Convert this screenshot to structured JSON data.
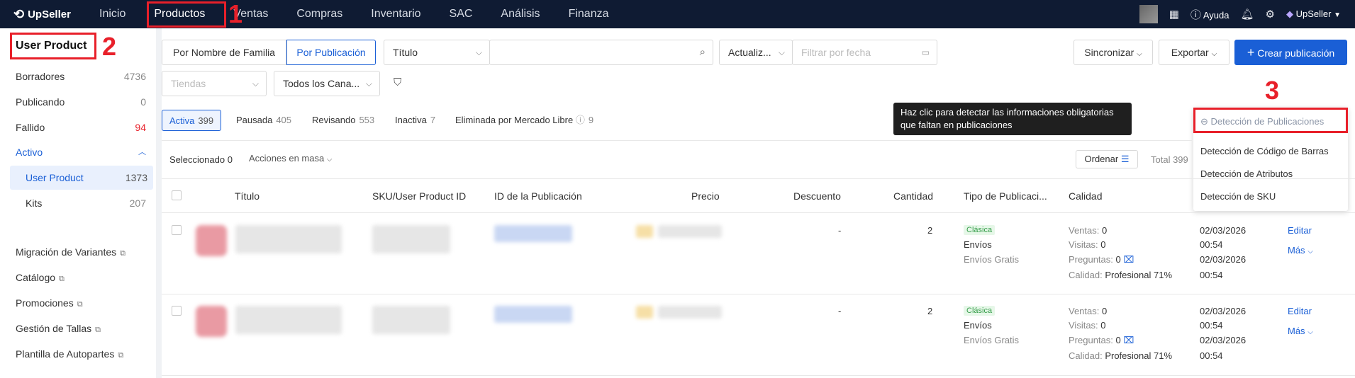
{
  "topbar": {
    "logo": "UpSeller",
    "nav": [
      "Inicio",
      "Productos",
      "Ventas",
      "Compras",
      "Inventario",
      "SAC",
      "Análisis",
      "Finanza"
    ],
    "help": "Ayuda",
    "account": "UpSeller"
  },
  "annotations": [
    "1",
    "2",
    "3"
  ],
  "sidebar": {
    "title": "User Product",
    "items": [
      {
        "label": "Borradores",
        "count": "4736"
      },
      {
        "label": "Publicando",
        "count": "0"
      },
      {
        "label": "Fallido",
        "count": "94"
      },
      {
        "label": "Activo",
        "count": ""
      },
      {
        "label": "User Product",
        "count": "1373"
      },
      {
        "label": "Kits",
        "count": "207"
      },
      {
        "label": "Migración de Variantes",
        "count": ""
      },
      {
        "label": "Catálogo",
        "count": ""
      },
      {
        "label": "Promociones",
        "count": ""
      },
      {
        "label": "Gestión de Tallas",
        "count": ""
      },
      {
        "label": "Plantilla de Autopartes",
        "count": ""
      }
    ],
    "colors": {
      "accent": "#1a5fd6",
      "fail_count": "#e8202a"
    }
  },
  "filters": {
    "mode_family": "Por Nombre de Familia",
    "mode_publication": "Por Publicación",
    "title_select": "Título",
    "search_value": "",
    "updated_select": "Actualiz...",
    "date_placeholder": "Filtrar por fecha",
    "sync": "Sincronizar",
    "export": "Exportar",
    "create": "Crear publicación",
    "stores_placeholder": "Tiendas",
    "channels": "Todos los Cana..."
  },
  "status_tabs": [
    {
      "label": "Activa",
      "count": "399"
    },
    {
      "label": "Pausada",
      "count": "405"
    },
    {
      "label": "Revisando",
      "count": "553"
    },
    {
      "label": "Inactiva",
      "count": "7"
    },
    {
      "label": "Eliminada por Mercado Libre",
      "count": "9"
    }
  ],
  "tooltip": "Haz clic para detectar las informaciones obligatorias que faltan en publicaciones",
  "detection": {
    "header": "Detección de Publicaciones",
    "items": [
      "Detección de Código de Barras",
      "Detección de Atributos",
      "Detección de SKU"
    ]
  },
  "toolbar": {
    "selected_label": "Seleccionado",
    "selected_count": "0",
    "bulk": "Acciones en masa",
    "sort": "Ordenar",
    "total": "Total 399"
  },
  "table": {
    "columns": [
      "Título",
      "SKU/User Product ID",
      "ID de la Publicación",
      "Precio",
      "Descuento",
      "Cantidad",
      "Tipo de Publicaci...",
      "Calidad"
    ],
    "rows": [
      {
        "discount": "-",
        "quantity": "2",
        "type_badge": "Clásica",
        "shipping": "Envíos",
        "free_shipping": "Envíos Gratis",
        "sales_label": "Ventas:",
        "sales": "0",
        "visits_label": "Visitas:",
        "visits": "0",
        "questions_label": "Preguntas:",
        "questions": "0",
        "quality_label": "Calidad:",
        "quality": "Profesional 71%",
        "date1": "02/03/2026",
        "time1": "00:54",
        "date2": "02/03/2026",
        "time2": "00:54",
        "edit": "Editar",
        "more": "Más"
      },
      {
        "discount": "-",
        "quantity": "2",
        "type_badge": "Clásica",
        "shipping": "Envíos",
        "free_shipping": "Envíos Gratis",
        "sales_label": "Ventas:",
        "sales": "0",
        "visits_label": "Visitas:",
        "visits": "0",
        "questions_label": "Preguntas:",
        "questions": "0",
        "quality_label": "Calidad:",
        "quality": "Profesional 71%",
        "date1": "02/03/2026",
        "time1": "00:54",
        "date2": "02/03/2026",
        "time2": "00:54",
        "edit": "Editar",
        "more": "Más"
      }
    ]
  },
  "icons": [
    "logo-icon",
    "grid-icon",
    "help-icon",
    "bell-icon",
    "gear-icon",
    "diamond-icon",
    "search-icon",
    "calendar-icon",
    "plus-icon",
    "filter-icon",
    "sort-icon",
    "detect-icon",
    "question-icon",
    "chevron-down-icon",
    "external-link-icon"
  ]
}
